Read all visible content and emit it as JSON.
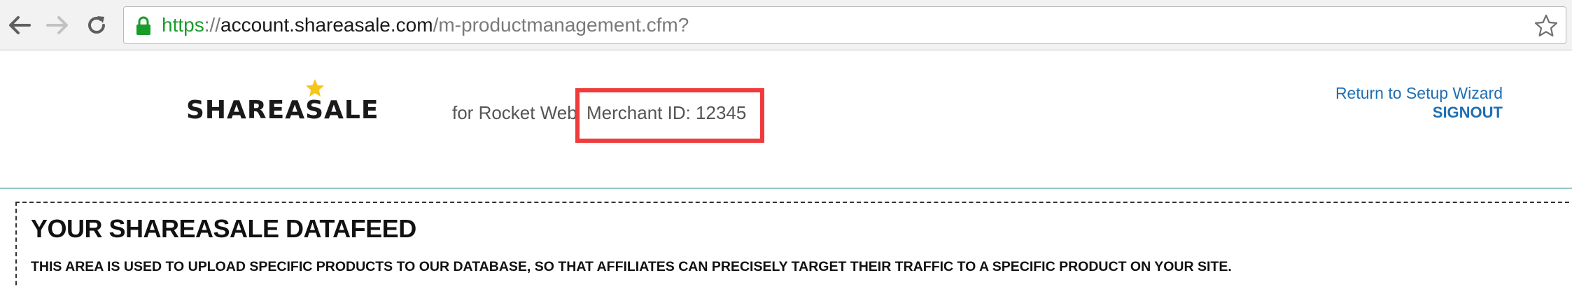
{
  "browser": {
    "url": {
      "scheme": "https",
      "separator": "://",
      "host": "account.shareasale.com",
      "path": "/m-productmanagement.cfm?"
    },
    "icons": [
      "back-arrow-icon",
      "forward-arrow-icon",
      "reload-icon",
      "lock-icon",
      "bookmark-star-icon"
    ]
  },
  "header": {
    "logo_text": "SHAREASALE",
    "merchant_name": "for Rocket Web",
    "merchant_id": "Merchant ID: 12345",
    "setup_wizard_link": "Return to Setup Wizard",
    "signout_link": "SIGNOUT"
  },
  "main": {
    "title": "YOUR SHAREASALE DATAFEED",
    "description": "THIS AREA IS USED TO UPLOAD SPECIFIC PRODUCTS TO OUR DATABASE, SO THAT AFFILIATES CAN PRECISELY TARGET THEIR TRAFFIC TO A SPECIFIC PRODUCT ON YOUR SITE."
  },
  "colors": {
    "url_scheme": "#1a9c2a",
    "link": "#1f6fb3",
    "highlight_box": "#ef3b3b",
    "header_rule": "#8fc9c9",
    "logo_star": "#f5c518"
  }
}
